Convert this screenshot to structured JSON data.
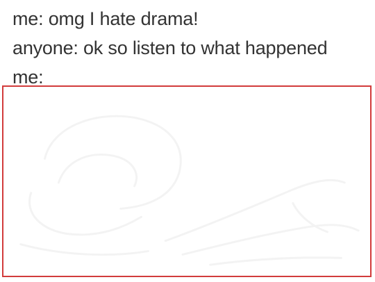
{
  "caption": {
    "lines": [
      "me: omg I hate drama!",
      "anyone: ok so listen to what happened",
      "me:"
    ]
  },
  "image": {
    "border_color": "#d23b3b",
    "content": "faint-sketch"
  }
}
